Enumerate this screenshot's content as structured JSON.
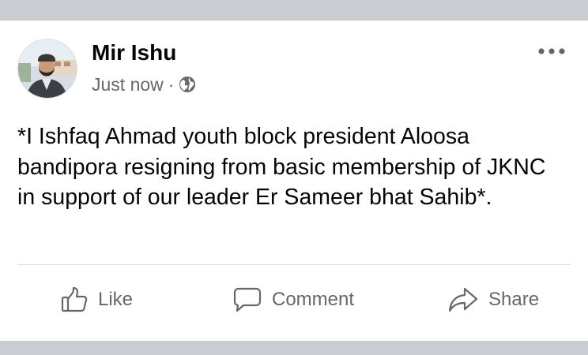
{
  "post": {
    "author_name": "Mir Ishu",
    "timestamp": "Just now",
    "separator": "·",
    "audience_icon": "globe-icon",
    "menu_icon": "more-options-icon",
    "text": "*I Ishfaq Ahmad youth block president Aloosa bandipora resigning from basic membership of JKNC in support of our leader Er Sameer bhat Sahib*."
  },
  "actions": {
    "like_label": "Like",
    "like_icon": "thumbs-up-icon",
    "comment_label": "Comment",
    "comment_icon": "speech-bubble-icon",
    "share_label": "Share",
    "share_icon": "share-arrow-icon"
  },
  "colors": {
    "page_background": "#c9ccd1",
    "card_background": "#ffffff",
    "primary_text": "#050505",
    "secondary_text": "#65676b",
    "divider": "#dcdee2"
  }
}
